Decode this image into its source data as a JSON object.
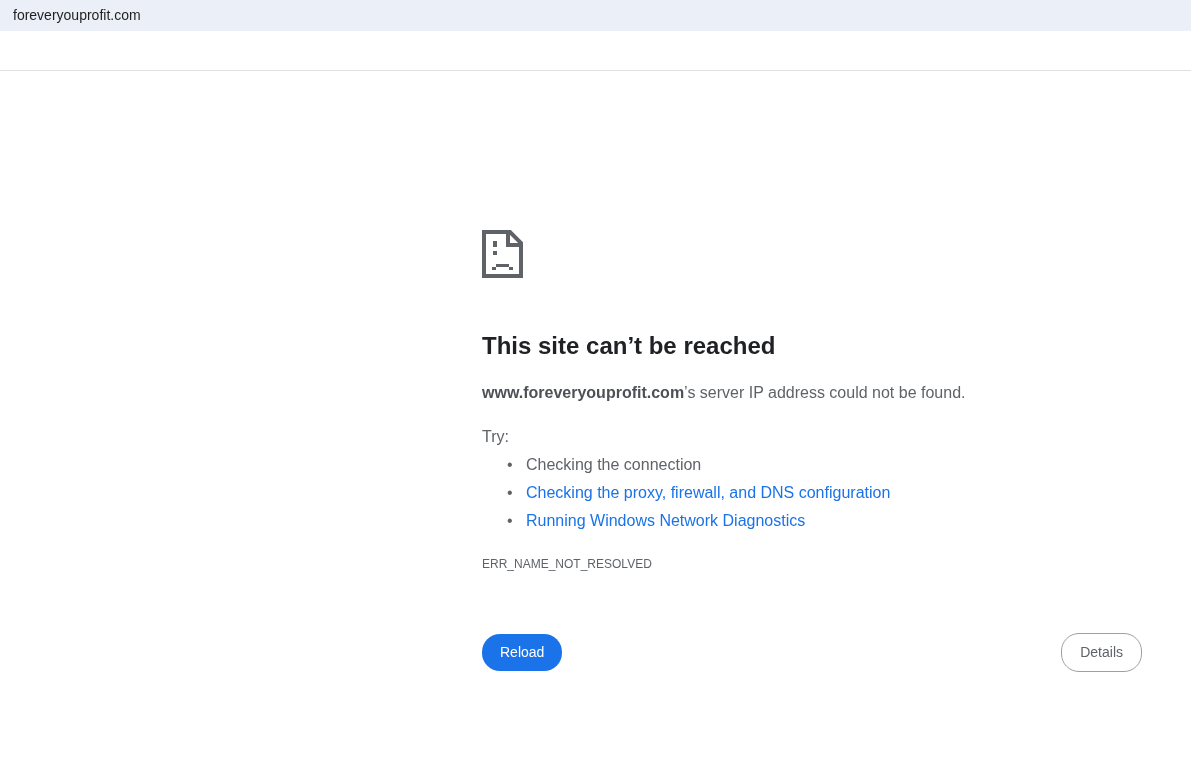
{
  "address_bar": {
    "url": "foreveryouprofit.com"
  },
  "error": {
    "heading": "This site can’t be reached",
    "message": "**www.foreveryouprofit.com**’s server IP address could not be found.",
    "try_label": "Try:",
    "suggestions": [
      {
        "kind": "text",
        "bullet": "•",
        "text": "Checking the connection"
      },
      {
        "kind": "link",
        "bullet": "•",
        "text": "Checking the proxy, firewall, and DNS configuration"
      },
      {
        "kind": "link",
        "bullet": "•",
        "text": "Running Windows Network Diagnostics"
      }
    ],
    "code": "ERR_NAME_NOT_RESOLVED"
  },
  "buttons": [
    {
      "kind": "primary",
      "label": "Reload"
    },
    {
      "kind": "secondary",
      "label": "Details"
    }
  ]
}
